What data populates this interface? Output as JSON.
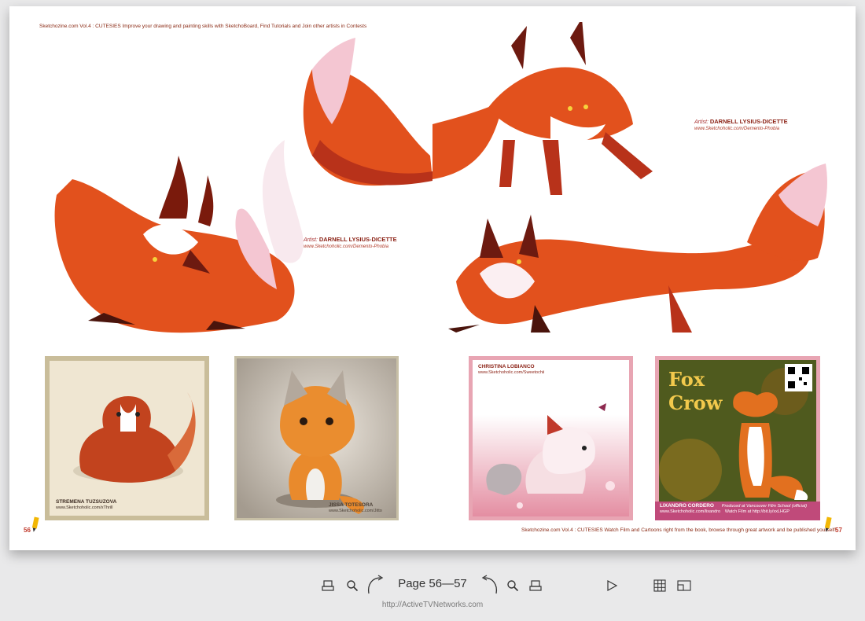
{
  "spread": {
    "left_page": {
      "running_head": "Sketchozine.com Vol.4 : CUTESIES    Improve your drawing and painting skills with SketchoBoard, Find Tutorials and Join other artists in Contests",
      "page_number": "56",
      "artist": {
        "label": "Artist:",
        "name": "DARNELL LYSIUS-DICETTE",
        "url": "www.Sketchoholic.com/Demento-Phobia"
      },
      "cards": [
        {
          "name": "STREMENA TUZSUZOVA",
          "url": "www.Sketchoholic.com/xThrill"
        },
        {
          "name": "JISSA TOTESORA",
          "url": "www.Sketchoholic.com/Jitto"
        }
      ]
    },
    "right_page": {
      "running_head": "Sketchozine.com Vol.4 : CUTESIES    Watch Film and Cartoons right from the book, browse through great artwork and be published yourself!",
      "page_number": "57",
      "artist": {
        "label": "Artist:",
        "name": "DARNELL LYSIUS-DICETTE",
        "url": "www.Sketchoholic.com/Demento-Phobia"
      },
      "cards": [
        {
          "name": "CHRISTINA LOBIANCO",
          "url": "www.Sketchoholic.com/Sweetochii"
        },
        {
          "name": "LIXANDRO CORDERO",
          "credit": "Produced at Vancouver Film School (official)",
          "url": "www.Sketchoholic.com/lixandro",
          "watch": "Watch Film at http://bit.ly/xxLHGP",
          "title_line1": "Fox",
          "title_line2": "Crow"
        }
      ]
    }
  },
  "toolbar": {
    "page_indicator": "Page 56—57",
    "icons": [
      "print-icon",
      "zoom-icon",
      "next-page-icon",
      "previous-page-icon",
      "zoom-icon",
      "print-icon",
      "play-icon",
      "grid-icon",
      "fullscreen-icon"
    ]
  },
  "footer": {
    "url": "http://ActiveTVNetworks.com"
  },
  "colors": {
    "accent": "#c0392b",
    "fox": "#e2511d",
    "pink": "#e9a4b7",
    "background": "#e9e9ea"
  }
}
